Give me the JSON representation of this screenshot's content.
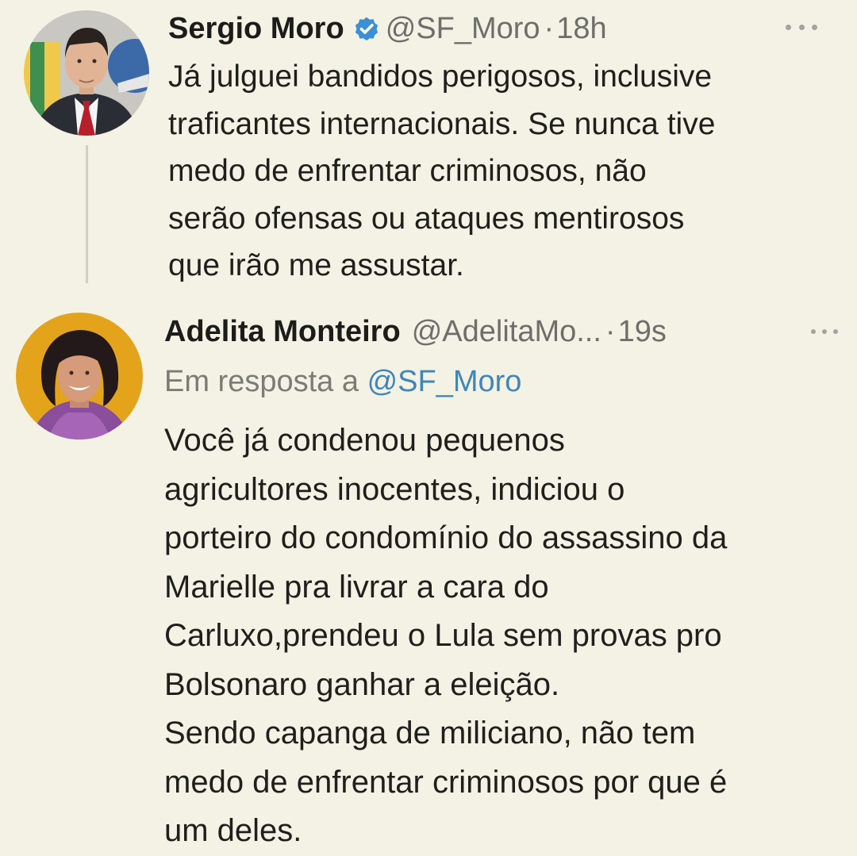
{
  "tweets": [
    {
      "author": {
        "name": "Sergio Moro",
        "handle": "@SF_Moro",
        "verified": true,
        "avatar": "avatar-photo"
      },
      "separator": "·",
      "time": "18h",
      "text": "Já julguei bandidos perigosos, inclusive\ntraficantes internacionais. Se nunca tive\nmedo de enfrentar criminosos, não\nserão ofensas ou ataques mentirosos\nque irão me assustar.",
      "more_icon": "more-horizontal-icon"
    },
    {
      "author": {
        "name": "Adelita Monteiro",
        "handle": "@AdelitaMo...",
        "verified": false,
        "avatar": "avatar-photo"
      },
      "separator": "·",
      "time": "19s",
      "reply_prefix": "Em resposta a",
      "reply_to": "@SF_Moro",
      "text": "Você já condenou pequenos\nagricultores inocentes, indiciou o\nporteiro do condomínio do assassino da\nMarielle pra livrar a cara do\nCarluxo,prendeu o Lula sem provas pro\nBolsonaro ganhar a eleição.\nSendo capanga de miliciano, não tem\nmedo de enfrentar criminosos por que é\num deles.",
      "more_icon": "more-horizontal-icon"
    }
  ],
  "colors": {
    "background": "#f3f2e4",
    "text": "#1f1f1c",
    "secondary_text": "#6e6f6a",
    "link": "#3f86bb",
    "verified": "#3b8fd4"
  }
}
